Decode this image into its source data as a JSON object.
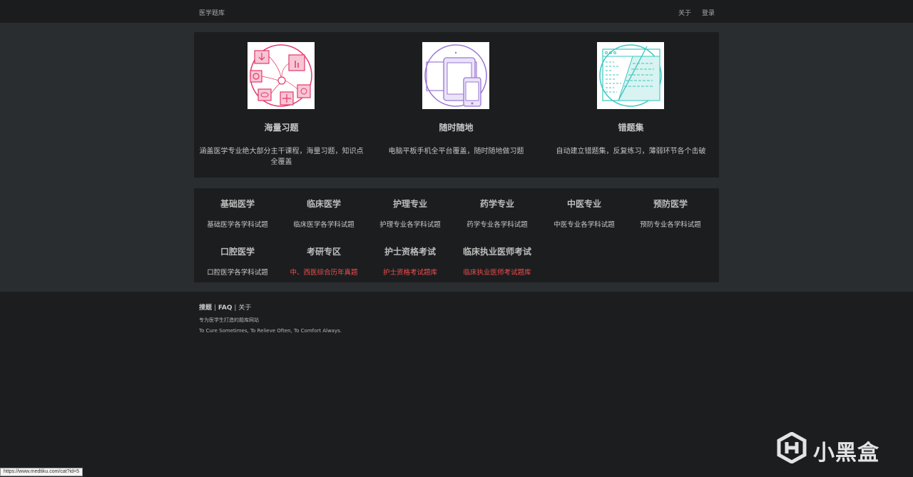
{
  "header": {
    "brand": "医学题库",
    "nav": [
      "关于",
      "登录"
    ]
  },
  "features": [
    {
      "icon": "practice-devices-icon",
      "title": "海量习题",
      "desc": "涵盖医学专业绝大部分主干课程，海量习题，知识点全覆盖",
      "color": "#e3386a"
    },
    {
      "icon": "tablet-phone-icon",
      "title": "随时随地",
      "desc": "电脑平板手机全平台覆盖，随时随地做习题",
      "color": "#9a77d6"
    },
    {
      "icon": "notebook-icon",
      "title": "错题集",
      "desc": "自动建立错题集，反复练习，薄弱环节各个击破",
      "color": "#3cc7c0"
    }
  ],
  "categories": [
    {
      "title": "基础医学",
      "desc": "基础医学各学科试题",
      "hot": false
    },
    {
      "title": "临床医学",
      "desc": "临床医学各学科试题",
      "hot": false
    },
    {
      "title": "护理专业",
      "desc": "护理专业各学科试题",
      "hot": false
    },
    {
      "title": "药学专业",
      "desc": "药学专业各学科试题",
      "hot": false
    },
    {
      "title": "中医专业",
      "desc": "中医专业各学科试题",
      "hot": false
    },
    {
      "title": "预防医学",
      "desc": "预防专业各学科试题",
      "hot": false
    },
    {
      "title": "口腔医学",
      "desc": "口腔医学各学科试题",
      "hot": false
    },
    {
      "title": "考研专区",
      "desc": "中、西医综合历年真题",
      "hot": true
    },
    {
      "title": "护士资格考试",
      "desc": "护士资格考试题库",
      "hot": true
    },
    {
      "title": "临床执业医师考试",
      "desc": "临床执业医师考试题库",
      "hot": true
    }
  ],
  "footer": {
    "links": [
      "搜题",
      "FAQ",
      "关于"
    ],
    "separator": "|",
    "tagline": "专为医学生打造的题库网站",
    "motto": "To Cure Sometimes, To Relieve Often, To Comfort Always."
  },
  "status_url": "https://www.medtiku.com/cat?id=5",
  "watermark": {
    "text": "小黑盒",
    "icon": "heybox-logo-icon"
  },
  "colors": {
    "hot": "#ef4e4e",
    "page_bg": "#1c1d1f",
    "band_bg": "#2a2d30"
  }
}
